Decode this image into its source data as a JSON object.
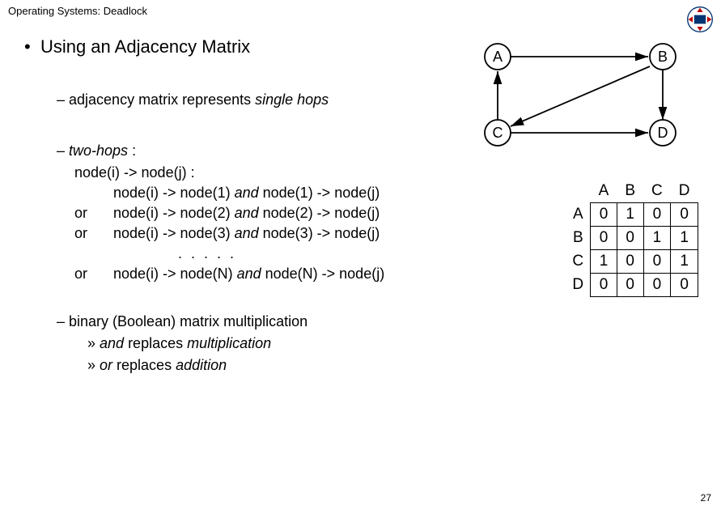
{
  "header": "Operating Systems: Deadlock",
  "main_bullet": "Using an Adjacency Matrix",
  "dash1_prefix": "– adjacency matrix represents ",
  "dash1_italic": "single hops",
  "dash2_prefix": "– ",
  "dash2_italic": "two-hops",
  "dash2_suffix": " :",
  "hop_intro": "node(i) -> node(j) :",
  "hops": [
    {
      "or": "",
      "pre": "node(i) -> node(1) ",
      "mid": "and",
      "post": " node(1) -> node(j)"
    },
    {
      "or": "or",
      "pre": "node(i) -> node(2) ",
      "mid": "and",
      "post": " node(2) -> node(j)"
    },
    {
      "or": "or",
      "pre": "node(i) -> node(3) ",
      "mid": "and",
      "post": " node(3) -> node(j)"
    }
  ],
  "dots": ". . . . .",
  "hop_last": {
    "or": "or",
    "pre": "node(i) -> node(N) ",
    "mid": "and",
    "post": " node(N) -> node(j)"
  },
  "dash3": "– binary (Boolean) matrix multiplication",
  "arrow1_pre": "» ",
  "arrow1_i1": "and",
  "arrow1_mid": " replaces ",
  "arrow1_i2": "multiplication",
  "arrow2_pre": "» ",
  "arrow2_i1": "or",
  "arrow2_mid": " replaces ",
  "arrow2_i2": "addition",
  "graph_nodes": {
    "A": "A",
    "B": "B",
    "C": "C",
    "D": "D"
  },
  "chart_data": {
    "type": "table",
    "title": "Adjacency Matrix",
    "columns": [
      "A",
      "B",
      "C",
      "D"
    ],
    "rows": [
      "A",
      "B",
      "C",
      "D"
    ],
    "values": [
      [
        0,
        1,
        0,
        0
      ],
      [
        0,
        0,
        1,
        1
      ],
      [
        1,
        0,
        0,
        1
      ],
      [
        0,
        0,
        0,
        0
      ]
    ]
  },
  "page_number": "27"
}
